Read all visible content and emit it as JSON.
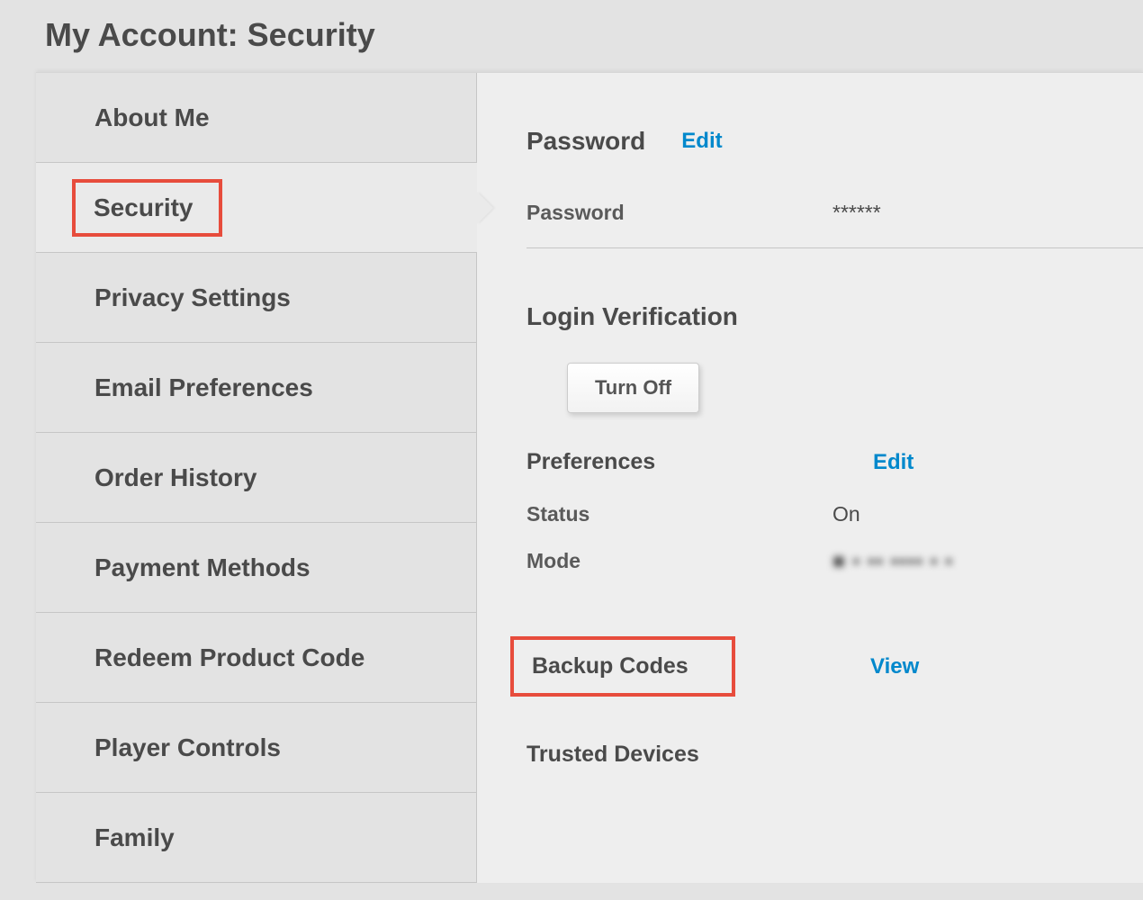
{
  "page_title": "My Account: Security",
  "sidebar": {
    "items": [
      {
        "label": "About Me"
      },
      {
        "label": "Security"
      },
      {
        "label": "Privacy Settings"
      },
      {
        "label": "Email Preferences"
      },
      {
        "label": "Order History"
      },
      {
        "label": "Payment Methods"
      },
      {
        "label": "Redeem Product Code"
      },
      {
        "label": "Player Controls"
      },
      {
        "label": "Family"
      }
    ],
    "active_index": 1
  },
  "content": {
    "password": {
      "title": "Password",
      "edit_label": "Edit",
      "field_label": "Password",
      "field_value": "******"
    },
    "login_verification": {
      "title": "Login Verification",
      "turn_off_label": "Turn Off",
      "preferences": {
        "title": "Preferences",
        "edit_label": "Edit",
        "status_label": "Status",
        "status_value": "On",
        "mode_label": "Mode",
        "mode_value": "■ ▪ ▪▪ ▪▪▪▪ ▪ ▪"
      }
    },
    "backup_codes": {
      "title": "Backup Codes",
      "view_label": "View"
    },
    "trusted_devices": {
      "title": "Trusted Devices"
    }
  },
  "colors": {
    "highlight_border": "#e74c3c",
    "link": "#0088cc",
    "text": "#4a4a4a",
    "bg": "#e3e3e3"
  }
}
